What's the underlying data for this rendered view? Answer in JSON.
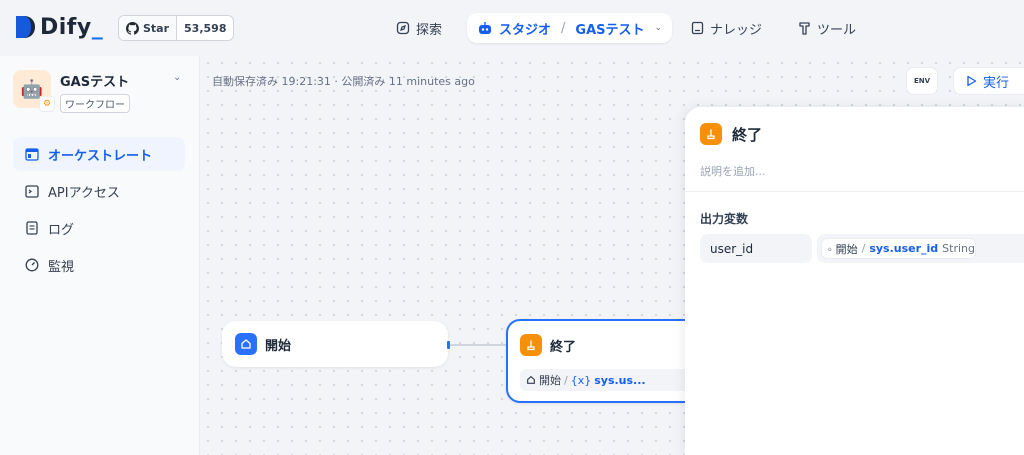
{
  "brand": {
    "name": "Dify",
    "cursor": "_"
  },
  "github": {
    "star_label": "Star",
    "star_count": "53,598"
  },
  "nav": {
    "explore": "探索",
    "studio": "スタジオ",
    "studio_separator": "/",
    "current_app": "GASテスト",
    "knowledge": "ナレッジ",
    "tools": "ツール"
  },
  "app": {
    "name": "GASテスト",
    "type": "ワークフロー"
  },
  "sidebar": {
    "items": [
      {
        "label": "オーケストレート",
        "icon": "layout-icon",
        "active": true
      },
      {
        "label": "APIアクセス",
        "icon": "terminal-icon",
        "active": false
      },
      {
        "label": "ログ",
        "icon": "document-icon",
        "active": false
      },
      {
        "label": "監視",
        "icon": "dashboard-icon",
        "active": false
      }
    ]
  },
  "toolbar": {
    "autosave": "自動保存済み 19:21:31 · 公開済み 11 minutes ago",
    "env_label": "ENV",
    "run_label": "実行"
  },
  "canvas": {
    "start_node": {
      "title": "開始"
    },
    "end_node": {
      "title": "終了",
      "var_source": "開始",
      "var_separator": "/",
      "var_icon": "{x}",
      "var_name": "sys.us..."
    }
  },
  "panel": {
    "title": "終了",
    "description_placeholder": "説明を追加...",
    "section_title": "出力変数",
    "outputs": [
      {
        "name": "user_id",
        "source": "開始",
        "separator": "/",
        "variable": "sys.user_id",
        "type": "String"
      }
    ]
  },
  "colors": {
    "accent": "#155eef",
    "start_node": "#2970ff",
    "end_node": "#f79009"
  }
}
